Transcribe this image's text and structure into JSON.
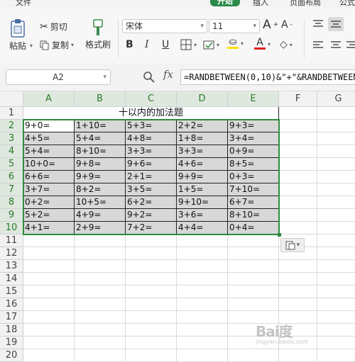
{
  "menubar": {
    "items": [
      "文件",
      "开始",
      "插入",
      "页面布局",
      "公式"
    ]
  },
  "ribbon": {
    "paste_label": "粘贴",
    "cut_label": "剪切",
    "copy_label": "复制",
    "format_painter_label": "格式刷",
    "font_name": "宋体",
    "font_size": "11",
    "bold_label": "B",
    "italic_label": "I",
    "underline_label": "U",
    "font_color_label": "A",
    "fill_color": "#ffe000",
    "font_color": "#e02020"
  },
  "formula_bar": {
    "name_box": "A2",
    "fx_label": "fx",
    "formula": "=RANDBETWEEN(0,10)&\"+\"&RANDBETWEEN(0,10)&\"=\""
  },
  "sheet": {
    "columns": [
      "A",
      "B",
      "C",
      "D",
      "E",
      "F",
      "G"
    ],
    "rows": [
      "1",
      "2",
      "3",
      "4",
      "5",
      "6",
      "7",
      "8",
      "9",
      "10",
      "11",
      "12",
      "13",
      "14",
      "15",
      "16",
      "17",
      "18",
      "19",
      "20"
    ],
    "title": "十以内的加法题",
    "problems": [
      [
        "9+0=",
        "1+10=",
        "5+3=",
        "2+2=",
        "9+3="
      ],
      [
        "4+5=",
        "5+4=",
        "4+8=",
        "1+8=",
        "3+4="
      ],
      [
        "5+4=",
        "8+10=",
        "3+3=",
        "3+3=",
        "0+9="
      ],
      [
        "10+0=",
        "9+8=",
        "9+6=",
        "4+6=",
        "8+5="
      ],
      [
        "6+6=",
        "9+9=",
        "2+1=",
        "9+9=",
        "0+3="
      ],
      [
        "3+7=",
        "8+2=",
        "3+5=",
        "1+5=",
        "7+10="
      ],
      [
        "0+2=",
        "10+5=",
        "6+2=",
        "9+10=",
        "6+7="
      ],
      [
        "5+2=",
        "4+9=",
        "9+2=",
        "3+6=",
        "8+10="
      ],
      [
        "4+1=",
        "2+9=",
        "7+2=",
        "4+4=",
        "0+4="
      ]
    ]
  },
  "watermark": {
    "main": "Bai度",
    "sub": "jingyan.baidu.com"
  }
}
